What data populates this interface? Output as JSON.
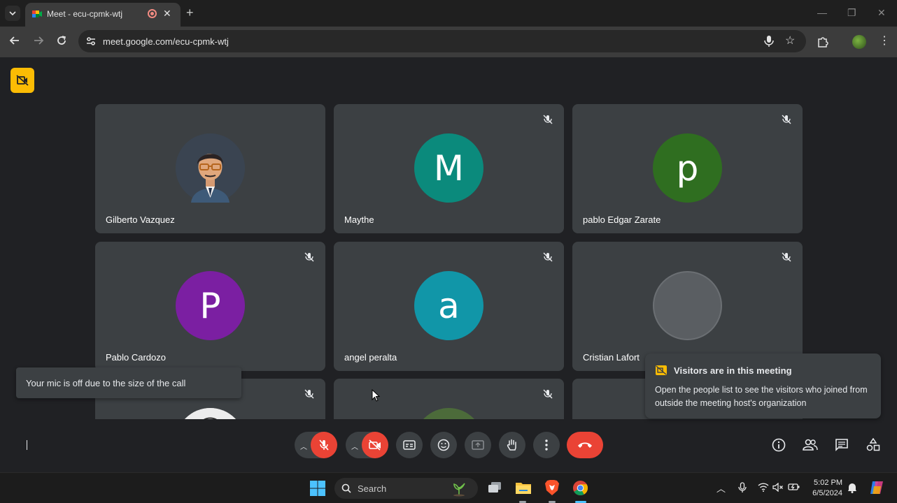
{
  "browser": {
    "tab_title": "Meet - ecu-cpmk-wtj",
    "new_tab_label": "+",
    "url": "meet.google.com/ecu-cpmk-wtj",
    "window_controls": [
      "—",
      "❐",
      "✕"
    ]
  },
  "participants": [
    {
      "name": "Gilberto Vazquez",
      "initial": "",
      "avatar_color": "#3a4451",
      "muted": false,
      "photo": true
    },
    {
      "name": "Maythe",
      "initial": "M",
      "avatar_color": "#0b8a7c",
      "muted": true
    },
    {
      "name": "pablo Edgar Zarate",
      "initial": "p",
      "avatar_color": "#2f6e20",
      "muted": true
    },
    {
      "name": "Pablo Cardozo",
      "initial": "P",
      "avatar_color": "#7b1fa2",
      "muted": true
    },
    {
      "name": "angel peralta",
      "initial": "a",
      "avatar_color": "#1196a8",
      "muted": true
    },
    {
      "name": "Cristian Lafort",
      "initial": "",
      "avatar_color": "#5a5e62",
      "muted": true
    },
    {
      "name": "",
      "initial": "",
      "avatar_color": "#e8e8e8",
      "muted": true,
      "photo": true
    },
    {
      "name": "",
      "initial": "",
      "avatar_color": "#4c6b3a",
      "muted": true,
      "photo": true
    },
    {
      "name": "",
      "initial": "",
      "avatar_color": "",
      "muted": false
    }
  ],
  "snackbar": {
    "text": "Your mic is off due to the size of the call"
  },
  "visitors_notice": {
    "title": "Visitors are in this meeting",
    "body": "Open the people list to see the visitors who joined from outside the meeting host's organization"
  },
  "taskbar": {
    "search_label": "Search",
    "time": "5:02 PM",
    "date": "6/5/2024"
  },
  "colors": {
    "danger": "#ea4335",
    "warning": "#fbbc04",
    "surface": "#3c4043",
    "background": "#202124"
  }
}
